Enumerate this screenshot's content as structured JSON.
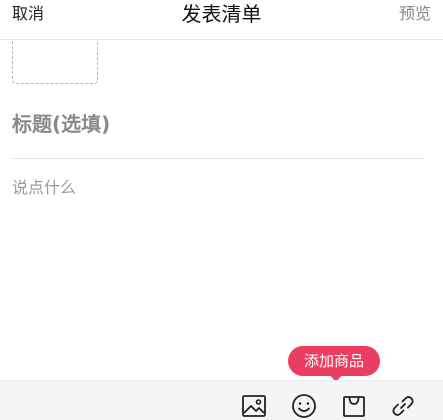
{
  "header": {
    "cancel_label": "取消",
    "title": "发表清单",
    "preview_label": "预览"
  },
  "editor": {
    "title_placeholder": "标题(选填)",
    "content_placeholder": "说点什么"
  },
  "tooltip": {
    "label": "添加商品"
  },
  "toolbar": {
    "tools": [
      "image-icon",
      "emoji-icon",
      "shopping-bag-icon",
      "link-icon"
    ]
  },
  "colors": {
    "accent": "#ea3d62",
    "toolbar_bg": "#f5f5f5",
    "placeholder": "#9a9a9a"
  }
}
